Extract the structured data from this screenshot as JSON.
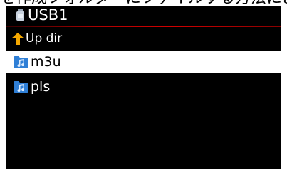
{
  "top_caption": "を作成フォルダーにファイルする方法により",
  "header": {
    "device_title": "USB1",
    "device_icon": "usb-drive-icon"
  },
  "up_dir": {
    "label": "Up dir",
    "icon": "up-arrow-icon",
    "icon_color": "#f5a800"
  },
  "items": [
    {
      "label": "m3u",
      "icon": "music-folder-icon",
      "selected": true
    },
    {
      "label": "pls",
      "icon": "music-folder-icon",
      "selected": false
    }
  ],
  "colors": {
    "background": "#000000",
    "text": "#ffffff",
    "selected_background": "#ffffff",
    "selected_text": "#000000",
    "divider": "#c00000",
    "folder_icon": "#2f7fd6"
  }
}
